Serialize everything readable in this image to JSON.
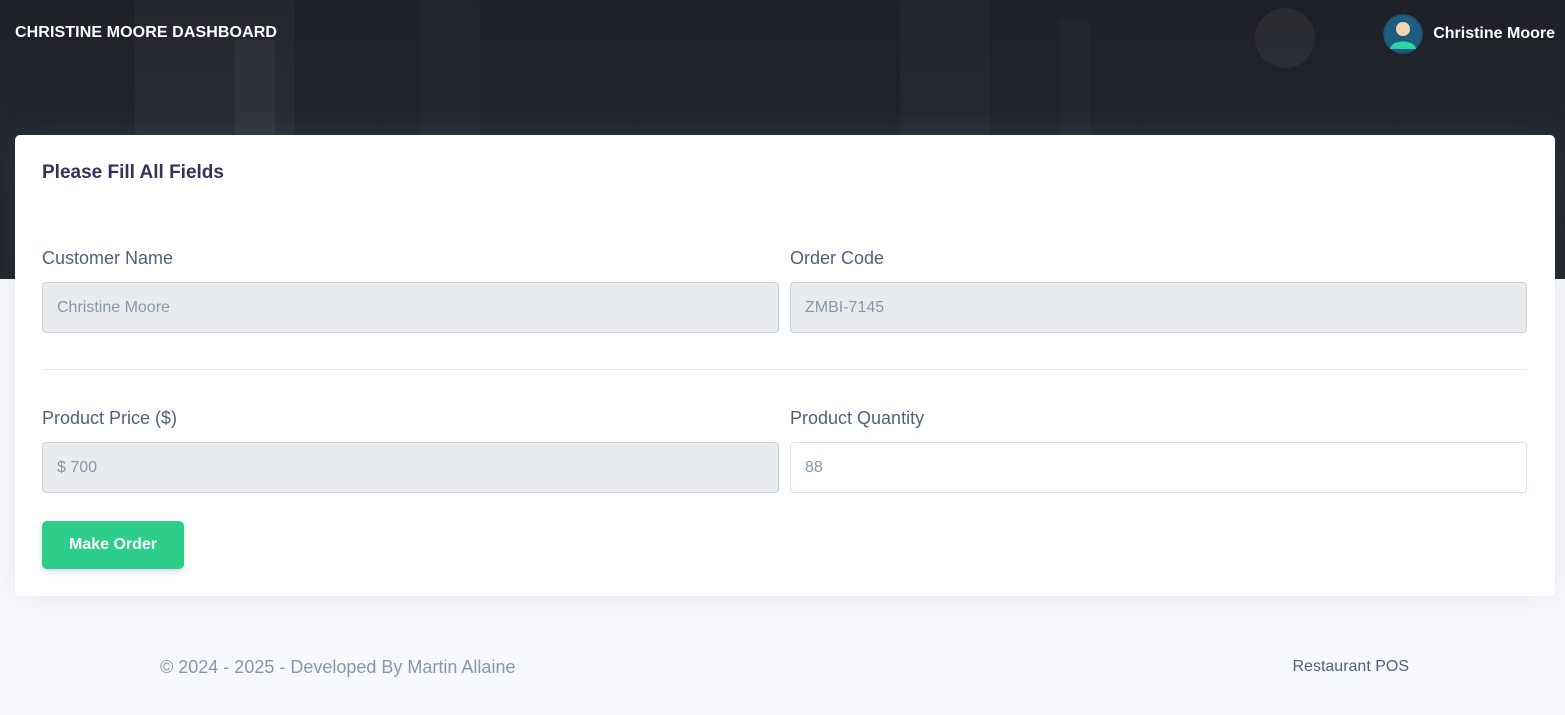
{
  "header": {
    "brand": "CHRISTINE MOORE DASHBOARD",
    "user_name": "Christine Moore"
  },
  "form": {
    "title": "Please Fill All Fields",
    "customer_name": {
      "label": "Customer Name",
      "value": "Christine Moore"
    },
    "order_code": {
      "label": "Order Code",
      "value": "ZMBI-7145"
    },
    "product_price": {
      "label": "Product Price ($)",
      "value": "$ 700"
    },
    "product_quantity": {
      "label": "Product Quantity",
      "value": "88"
    },
    "submit_label": "Make Order"
  },
  "footer": {
    "copyright": "© 2024 - 2025 - Developed By Martin Allaine",
    "link": "Restaurant POS"
  },
  "colors": {
    "success": "#2dce89",
    "hero_bg": "#1f2229",
    "page_bg": "#f7f8fc"
  }
}
